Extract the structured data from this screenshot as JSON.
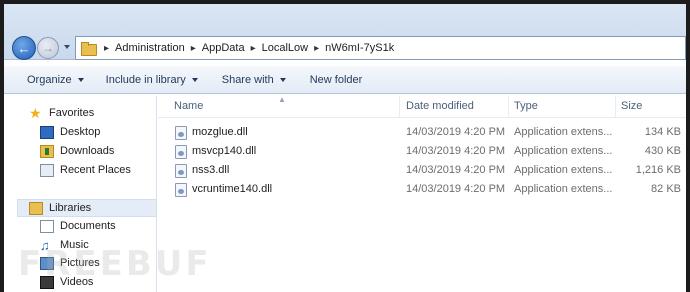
{
  "address": {
    "crumbs": [
      "Administration",
      "AppData",
      "LocalLow",
      "nW6mI-7yS1k"
    ]
  },
  "toolbar": {
    "organize": "Organize",
    "include_in_library": "Include in library",
    "share_with": "Share with",
    "new_folder": "New folder"
  },
  "nav": {
    "favorites": "Favorites",
    "desktop": "Desktop",
    "downloads": "Downloads",
    "recent_places": "Recent Places",
    "libraries": "Libraries",
    "documents": "Documents",
    "music": "Music",
    "pictures": "Pictures",
    "videos": "Videos"
  },
  "columns": {
    "name": "Name",
    "date_modified": "Date modified",
    "type": "Type",
    "size": "Size"
  },
  "files": [
    {
      "name": "mozglue.dll",
      "date": "14/03/2019 4:20 PM",
      "type": "Application extens...",
      "size": "134 KB"
    },
    {
      "name": "msvcp140.dll",
      "date": "14/03/2019 4:20 PM",
      "type": "Application extens...",
      "size": "430 KB"
    },
    {
      "name": "nss3.dll",
      "date": "14/03/2019 4:20 PM",
      "type": "Application extens...",
      "size": "1,216 KB"
    },
    {
      "name": "vcruntime140.dll",
      "date": "14/03/2019 4:20 PM",
      "type": "Application extens...",
      "size": "82 KB"
    }
  ],
  "watermark": "FREEBUF"
}
